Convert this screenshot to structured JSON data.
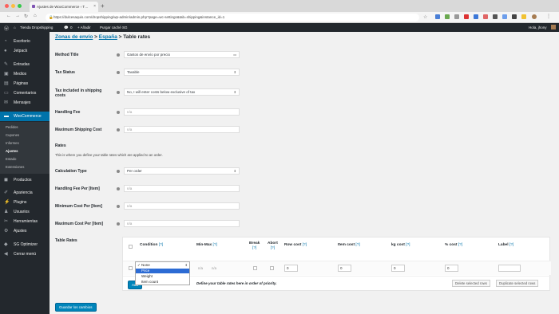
{
  "browser": {
    "tab_title": "Ajustes de WooCommerce ‹ T…",
    "url": "https://dulcesaquis.com/dropshipping/wp-admin/admin.php?page=wc-settings&tab=shipping&instance_id=1"
  },
  "adminbar": {
    "site": "Tienda Dropshipping",
    "comments": "0",
    "new": "+ Añadir",
    "cache": "Purgar caché SG",
    "greeting": "Hola, jhony"
  },
  "sidebar": {
    "items": [
      {
        "label": "Escritorio",
        "icon": "dashboard-icon"
      },
      {
        "label": "Jetpack",
        "icon": "jetpack-icon"
      },
      {
        "label": "Entradas",
        "icon": "pin-icon"
      },
      {
        "label": "Medios",
        "icon": "media-icon"
      },
      {
        "label": "Páginas",
        "icon": "pages-icon"
      },
      {
        "label": "Comentarios",
        "icon": "comment-icon"
      },
      {
        "label": "Mensajes",
        "icon": "mail-icon"
      },
      {
        "label": "WooCommerce",
        "icon": "woo-icon"
      },
      {
        "label": "Productos",
        "icon": "box-icon"
      },
      {
        "label": "Apariencia",
        "icon": "brush-icon"
      },
      {
        "label": "Plugins",
        "icon": "plugin-icon"
      },
      {
        "label": "Usuarios",
        "icon": "user-icon"
      },
      {
        "label": "Herramientas",
        "icon": "wrench-icon"
      },
      {
        "label": "Ajustes",
        "icon": "settings-icon"
      },
      {
        "label": "SG Optimizer",
        "icon": "sg-icon"
      },
      {
        "label": "Cerrar menú",
        "icon": "collapse-icon"
      }
    ],
    "woo_sub": [
      "Pedidos",
      "Cupones",
      "Informes",
      "Ajustes",
      "Estado",
      "Extensiones"
    ]
  },
  "breadcrumb": {
    "zones": "Zonas de envío",
    "sep1": " > ",
    "country": "España",
    "sep2": " > ",
    "current": "Table rates"
  },
  "form": {
    "method_title_label": "Method Title",
    "method_title_value": "Gastos de envío por precio",
    "tax_status_label": "Tax Status",
    "tax_status_value": "Taxable",
    "tax_included_label": "Tax included in shipping costs",
    "tax_included_value": "No, I will enter costs below exclusive of tax",
    "handling_fee_label": "Handling Fee",
    "handling_fee_placeholder": "n/a",
    "max_shipping_label": "Maximum Shipping Cost",
    "max_shipping_placeholder": "n/a",
    "rates_heading": "Rates",
    "rates_desc": "This is where you define your table rates which are applied to an order.",
    "calc_type_label": "Calculation Type",
    "calc_type_value": "Per order",
    "handling_item_label": "Handling Fee Per [Item]",
    "handling_item_placeholder": "n/a",
    "min_cost_label": "Minimum Cost Per [Item]",
    "min_cost_placeholder": "n/a",
    "max_cost_label": "Maximum Cost Per [Item]",
    "max_cost_placeholder": "n/a",
    "table_rates_label": "Table Rates"
  },
  "table": {
    "headers": {
      "condition": "Condition",
      "minmax": "Min-Max",
      "break": "Break",
      "abort": "Abort",
      "row_cost": "Row cost",
      "item_cost": "Item cost",
      "kg_cost": "kg cost",
      "pct_cost": "% cost",
      "label": "Label",
      "help": "[?]"
    },
    "row": {
      "condition": "✓ None",
      "min_placeholder": "n/a",
      "max_placeholder": "n/a",
      "row_cost": "0",
      "item_cost": "0",
      "kg_cost": "0",
      "pct_cost": "0"
    },
    "dropdown_options": [
      "✓ None",
      "Price",
      "Weight",
      "Item count"
    ],
    "add_button": "Add",
    "define_text": "Define your table rates here in order of priority.",
    "delete_button": "Delete selected rows",
    "duplicate_button": "Duplicate selected rows"
  },
  "save_button": "Guardar los cambios",
  "colors": {
    "accent": "#0073aa",
    "sidebar": "#23282d",
    "button": "#0085ba",
    "dropdown_highlight": "#2c6bd4"
  }
}
